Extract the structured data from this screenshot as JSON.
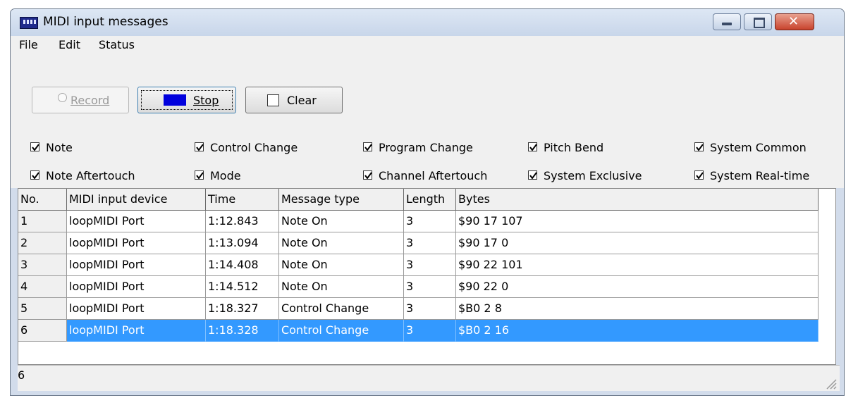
{
  "window": {
    "title": "MIDI input messages",
    "icon": "midi-keyboard-icon",
    "controls": [
      "minimize-icon",
      "maximize-icon",
      "close-icon"
    ]
  },
  "menu": {
    "items": [
      "File",
      "Edit",
      "Status"
    ]
  },
  "toolbar": {
    "record_label": "Record",
    "stop_label": "Stop",
    "clear_label": "Clear"
  },
  "filters": [
    {
      "label": "Note",
      "checked": true
    },
    {
      "label": "Control Change",
      "checked": true
    },
    {
      "label": "Program Change",
      "checked": true
    },
    {
      "label": "Pitch Bend",
      "checked": true
    },
    {
      "label": "System Common",
      "checked": true
    },
    {
      "label": "Note Aftertouch",
      "checked": true
    },
    {
      "label": "Mode",
      "checked": true
    },
    {
      "label": "Channel Aftertouch",
      "checked": true
    },
    {
      "label": "System Exclusive",
      "checked": true
    },
    {
      "label": "System Real-time",
      "checked": true
    }
  ],
  "table": {
    "columns": [
      "No.",
      "MIDI input device",
      "Time",
      "Message type",
      "Length",
      "Bytes"
    ],
    "rows": [
      [
        "1",
        "loopMIDI Port",
        "1:12.843",
        "Note On",
        "3",
        "$90 17 107"
      ],
      [
        "2",
        "loopMIDI Port",
        "1:13.094",
        "Note On",
        "3",
        "$90 17 0"
      ],
      [
        "3",
        "loopMIDI Port",
        "1:14.408",
        "Note On",
        "3",
        "$90 22 101"
      ],
      [
        "4",
        "loopMIDI Port",
        "1:14.512",
        "Note On",
        "3",
        "$90 22 0"
      ],
      [
        "5",
        "loopMIDI Port",
        "1:18.327",
        "Control Change",
        "3",
        "$B0 2 8"
      ],
      [
        "6",
        "loopMIDI Port",
        "1:18.328",
        "Control Change",
        "3",
        "$B0 2 16"
      ]
    ],
    "selected_row": 6
  },
  "status": {
    "text": "6"
  },
  "colors": {
    "selection": "#3399ff",
    "stop_square": "#0000dd",
    "close_button": "#c8432d"
  }
}
